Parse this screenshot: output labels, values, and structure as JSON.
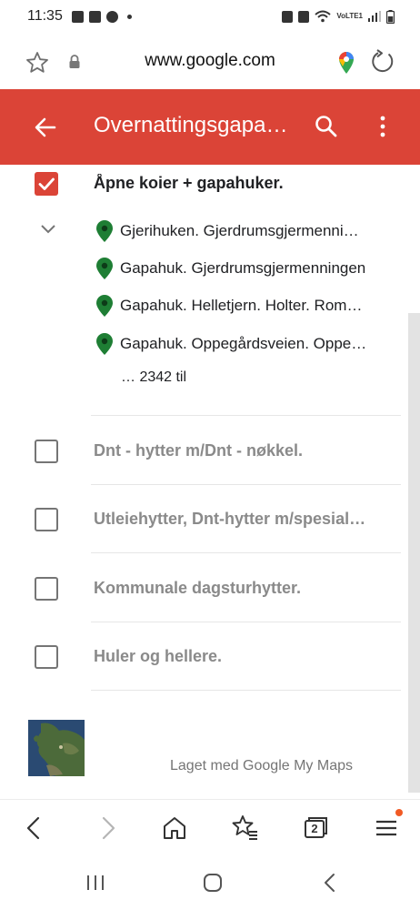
{
  "status_bar": {
    "time": "11:35",
    "network_label": "VoLTE1"
  },
  "browser": {
    "url": "www.google.com"
  },
  "app_bar": {
    "title": "Overnattingsgapahuker",
    "accent_color": "#db4437"
  },
  "layers": [
    {
      "title": "Åpne koier + gapahuker.",
      "checked": true,
      "expanded": true,
      "places": [
        "Gjerihuken. Gjerdrumsgjermenningen",
        "Gapahuk. Gjerdrumsgjermenningen",
        "Gapahuk. Helletjern. Holter. Romerike",
        "Gapahuk. Oppegårdsveien. Oppegård"
      ],
      "more_label": "… 2342 til"
    },
    {
      "title": "Dnt - hytter m/Dnt - nøkkel.",
      "checked": false
    },
    {
      "title": "Utleiehytter, Dnt-hytter m/spesialnøkkel.",
      "checked": false
    },
    {
      "title": "Kommunale dagsturhytter.",
      "checked": false
    },
    {
      "title": "Huler og hellere.",
      "checked": false
    }
  ],
  "footer": {
    "credit": "Laget med Google My Maps"
  },
  "bottom_nav": {
    "tabs_count": "2"
  },
  "icons": {
    "place_pin_color": "#1e7e34",
    "notification_dot_color": "#f15a24"
  }
}
